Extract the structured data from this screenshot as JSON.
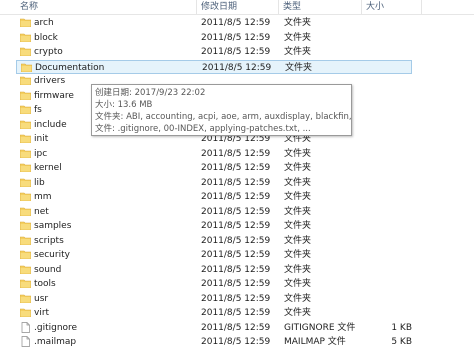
{
  "columns": {
    "name": "名称",
    "date": "修改日期",
    "type": "类型",
    "size": "大小"
  },
  "colors": {
    "folder": "#f4cf5f",
    "folder_dark": "#d9a93a",
    "selection_bg": "#e5f3fb",
    "selection_border": "#a5cbe8"
  },
  "files": [
    {
      "name": "arch",
      "date": "2011/8/5 12:59",
      "type": "文件夹",
      "size": "",
      "icon": "folder-icon"
    },
    {
      "name": "block",
      "date": "2011/8/5 12:59",
      "type": "文件夹",
      "size": "",
      "icon": "folder-icon"
    },
    {
      "name": "crypto",
      "date": "2011/8/5 12:59",
      "type": "文件夹",
      "size": "",
      "icon": "folder-icon"
    },
    {
      "name": "Documentation",
      "date": "2011/8/5 12:59",
      "type": "文件夹",
      "size": "",
      "icon": "folder-icon",
      "selected": true
    },
    {
      "name": "drivers",
      "date": "",
      "type": "",
      "size": "",
      "icon": "folder-icon"
    },
    {
      "name": "firmware",
      "date": "",
      "type": "",
      "size": "",
      "icon": "folder-icon"
    },
    {
      "name": "fs",
      "date": "",
      "type": "",
      "size": "",
      "icon": "folder-icon"
    },
    {
      "name": "include",
      "date": "",
      "type": "",
      "size": "",
      "icon": "folder-icon"
    },
    {
      "name": "init",
      "date": "2011/8/5 12:59",
      "type": "文件夹",
      "size": "",
      "icon": "folder-icon"
    },
    {
      "name": "ipc",
      "date": "2011/8/5 12:59",
      "type": "文件夹",
      "size": "",
      "icon": "folder-icon"
    },
    {
      "name": "kernel",
      "date": "2011/8/5 12:59",
      "type": "文件夹",
      "size": "",
      "icon": "folder-icon"
    },
    {
      "name": "lib",
      "date": "2011/8/5 12:59",
      "type": "文件夹",
      "size": "",
      "icon": "folder-icon"
    },
    {
      "name": "mm",
      "date": "2011/8/5 12:59",
      "type": "文件夹",
      "size": "",
      "icon": "folder-icon"
    },
    {
      "name": "net",
      "date": "2011/8/5 12:59",
      "type": "文件夹",
      "size": "",
      "icon": "folder-icon"
    },
    {
      "name": "samples",
      "date": "2011/8/5 12:59",
      "type": "文件夹",
      "size": "",
      "icon": "folder-icon"
    },
    {
      "name": "scripts",
      "date": "2011/8/5 12:59",
      "type": "文件夹",
      "size": "",
      "icon": "folder-icon"
    },
    {
      "name": "security",
      "date": "2011/8/5 12:59",
      "type": "文件夹",
      "size": "",
      "icon": "folder-icon"
    },
    {
      "name": "sound",
      "date": "2011/8/5 12:59",
      "type": "文件夹",
      "size": "",
      "icon": "folder-icon"
    },
    {
      "name": "tools",
      "date": "2011/8/5 12:59",
      "type": "文件夹",
      "size": "",
      "icon": "folder-icon"
    },
    {
      "name": "usr",
      "date": "2011/8/5 12:59",
      "type": "文件夹",
      "size": "",
      "icon": "folder-icon"
    },
    {
      "name": "virt",
      "date": "2011/8/5 12:59",
      "type": "文件夹",
      "size": "",
      "icon": "folder-icon"
    },
    {
      "name": ".gitignore",
      "date": "2011/8/5 12:59",
      "type": "GITIGNORE 文件",
      "size": "1 KB",
      "icon": "file-icon"
    },
    {
      "name": ".mailmap",
      "date": "2011/8/5 12:59",
      "type": "MAILMAP 文件",
      "size": "5 KB",
      "icon": "file-icon"
    }
  ],
  "tooltip": {
    "created": "创建日期: 2017/9/23 22:02",
    "size": "大小: 13.6 MB",
    "folders": "文件夹: ABI, accounting, acpi, aoe, arm, auxdisplay, blackfin, ...",
    "files": "文件: .gitignore, 00-INDEX, applying-patches.txt, ..."
  }
}
